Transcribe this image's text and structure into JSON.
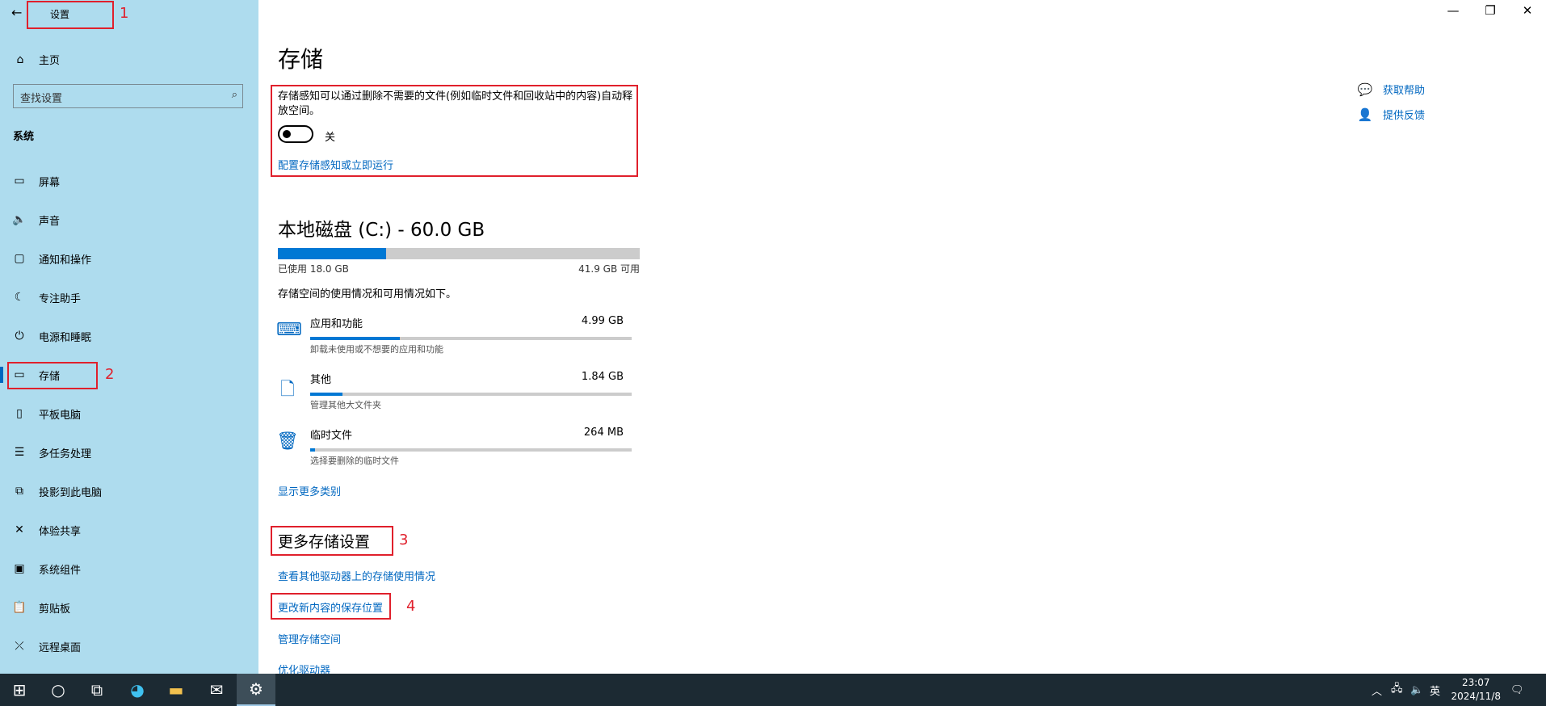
{
  "window": {
    "app_title": "设置",
    "controls": {
      "minimize": "—",
      "restore": "❐",
      "close": "✕"
    }
  },
  "sidebar": {
    "home_label": "主页",
    "search_placeholder": "查找设置",
    "group_label": "系统",
    "items": [
      {
        "label": "屏幕",
        "icon": "monitor-icon",
        "glyph": "▭"
      },
      {
        "label": "声音",
        "icon": "speaker-icon",
        "glyph": "🔈"
      },
      {
        "label": "通知和操作",
        "icon": "notification-icon",
        "glyph": "▢"
      },
      {
        "label": "专注助手",
        "icon": "moon-icon",
        "glyph": "☾"
      },
      {
        "label": "电源和睡眠",
        "icon": "power-icon",
        "glyph": "⏻"
      },
      {
        "label": "存储",
        "icon": "storage-icon",
        "glyph": "▭"
      },
      {
        "label": "平板电脑",
        "icon": "tablet-icon",
        "glyph": "▯"
      },
      {
        "label": "多任务处理",
        "icon": "multitask-icon",
        "glyph": "☰"
      },
      {
        "label": "投影到此电脑",
        "icon": "project-icon",
        "glyph": "⧉"
      },
      {
        "label": "体验共享",
        "icon": "share-icon",
        "glyph": "✕"
      },
      {
        "label": "系统组件",
        "icon": "components-icon",
        "glyph": "▣"
      },
      {
        "label": "剪贴板",
        "icon": "clipboard-icon",
        "glyph": "📋"
      },
      {
        "label": "远程桌面",
        "icon": "remote-icon",
        "glyph": "⤫"
      }
    ],
    "selected_index": 5
  },
  "annotations": {
    "n1": "1",
    "n2": "2",
    "n3": "3",
    "n4": "4"
  },
  "main": {
    "title": "存储",
    "sense_desc": "存储感知可以通过删除不需要的文件(例如临时文件和回收站中的内容)自动释放空间。",
    "toggle_state": "关",
    "sense_link": "配置存储感知或立即运行",
    "disk_title": "本地磁盘 (C:) - 60.0 GB",
    "disk_used_fraction": 0.3,
    "disk_used_label": "已使用 18.0 GB",
    "disk_free_label": "41.9 GB 可用",
    "usage_desc": "存储空间的使用情况和可用情况如下。",
    "categories": [
      {
        "name": "应用和功能",
        "size": "4.99 GB",
        "sub": "卸载未使用或不想要的应用和功能",
        "fraction": 0.28,
        "icon": "keyboard-icon",
        "glyph": "⌨"
      },
      {
        "name": "其他",
        "size": "1.84 GB",
        "sub": "管理其他大文件夹",
        "fraction": 0.1,
        "icon": "file-icon",
        "glyph": "🗋"
      },
      {
        "name": "临时文件",
        "size": "264 MB",
        "sub": "选择要删除的临时文件",
        "fraction": 0.015,
        "icon": "trash-icon",
        "glyph": "🗑"
      }
    ],
    "show_more": "显示更多类别",
    "more_title": "更多存储设置",
    "more_links": [
      "查看其他驱动器上的存储使用情况",
      "更改新内容的保存位置",
      "管理存储空间",
      "优化驱动器"
    ]
  },
  "help": {
    "get_help": "获取帮助",
    "feedback": "提供反馈"
  },
  "taskbar": {
    "apps": [
      "start-icon",
      "search-icon",
      "task-view-icon",
      "edge-icon",
      "explorer-icon",
      "mail-icon",
      "settings-icon"
    ],
    "tray_ime": "英",
    "time": "23:07",
    "date": "2024/11/8"
  }
}
